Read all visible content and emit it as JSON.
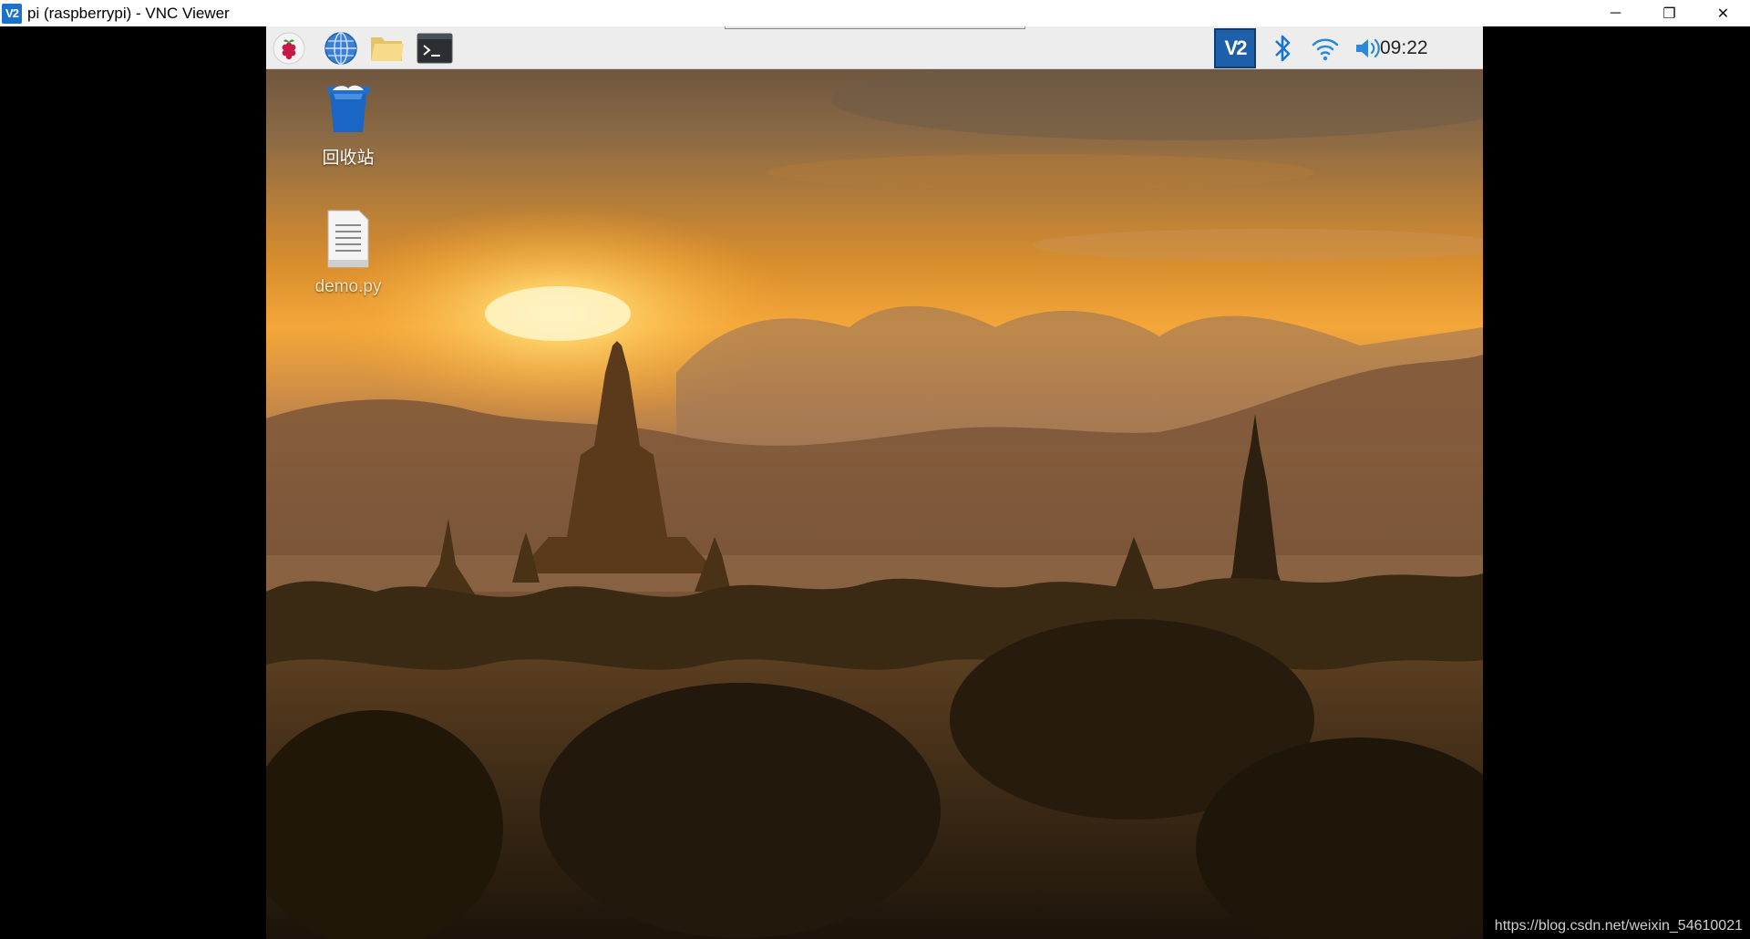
{
  "window": {
    "app_icon_text": "V2",
    "title": "pi (raspberrypi) - VNC Viewer",
    "controls": {
      "minimize": "─",
      "restore": "❐",
      "close": "✕"
    }
  },
  "taskbar": {
    "launchers": [
      {
        "icon": "raspberry-menu-icon"
      },
      {
        "icon": "web-browser-icon"
      },
      {
        "icon": "file-manager-icon"
      },
      {
        "icon": "terminal-icon"
      }
    ],
    "tray": {
      "vnc_text": "V2",
      "clock": "09:22"
    }
  },
  "desktop": {
    "icons": [
      {
        "icon": "trash-icon",
        "label": "回收站"
      },
      {
        "icon": "text-file-icon",
        "label": "demo.py"
      }
    ]
  },
  "watermark": "https://blog.csdn.net/weixin_54610021",
  "colors": {
    "accent": "#1d5fa8",
    "sky_glow": "#f6a83a",
    "bluetooth": "#1a75d2"
  }
}
